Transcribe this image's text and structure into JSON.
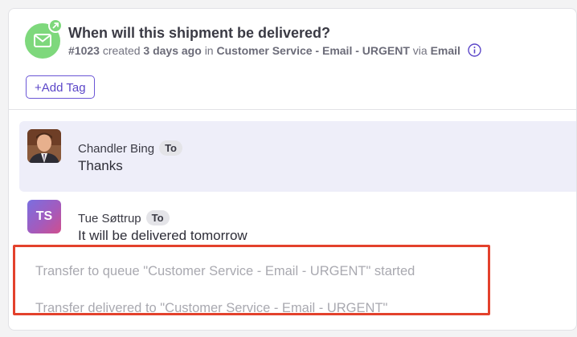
{
  "conversation": {
    "title": "When will this shipment be delivered?",
    "meta": {
      "id": "#1023",
      "created_label": "created",
      "age": "3 days ago",
      "in_label": "in",
      "queue": "Customer Service - Email - URGENT",
      "via_label": "via",
      "channel": "Email"
    },
    "channel_icon": "email-outbound-icon",
    "info_icon": "info-icon",
    "add_tag_label": "+Add Tag"
  },
  "messages": [
    {
      "sender": "Chandler Bing",
      "role": "To",
      "text": "Thanks",
      "avatar": "photo",
      "highlighted": true
    },
    {
      "sender": "Tue Søttrup",
      "role": "To",
      "text": "It will be delivered tomorrow",
      "avatar_initials": "TS",
      "highlighted": false
    }
  ],
  "events": [
    "Transfer to queue \"Customer Service - Email - URGENT\" started",
    "Transfer delivered to \"Customer Service - Email - URGENT\""
  ],
  "colors": {
    "accent": "#5b46c8",
    "channel_green": "#7ed87c",
    "highlight_bg": "#eeeef9",
    "annotation_red": "#e3412c"
  }
}
